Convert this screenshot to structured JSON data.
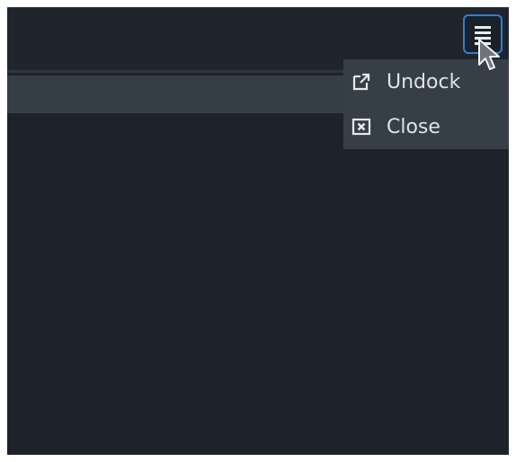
{
  "menu": {
    "items": [
      {
        "label": "Undock",
        "icon": "external-link-icon"
      },
      {
        "label": "Close",
        "icon": "close-box-icon"
      }
    ]
  },
  "toolbar": {
    "menu_button_icon": "hamburger-menu-icon"
  },
  "colors": {
    "panel_bg": "#1e232b",
    "row_highlight": "#353e46",
    "menu_bg": "#363e46",
    "accent_border": "#2e7fd0",
    "text": "#dfe3e7"
  }
}
